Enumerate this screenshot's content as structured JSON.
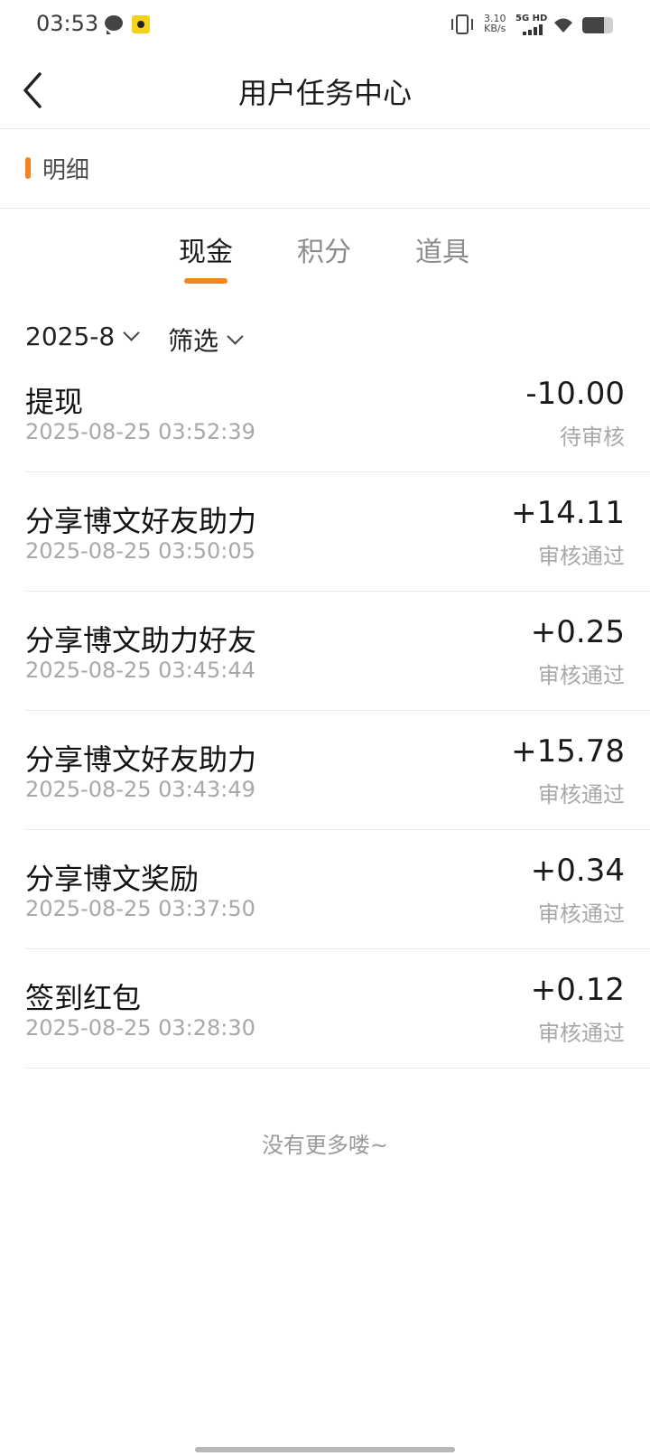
{
  "status_bar": {
    "time": "03:53",
    "speed_value": "3.10",
    "speed_unit": "KB/s",
    "network": "5G HD"
  },
  "header": {
    "title": "用户任务中心"
  },
  "section": {
    "title": "明细",
    "accent": "#f5831f"
  },
  "tabs": [
    {
      "label": "现金",
      "active": true
    },
    {
      "label": "积分",
      "active": false
    },
    {
      "label": "道具",
      "active": false
    }
  ],
  "filters": {
    "month": "2025-8",
    "filter_label": "筛选"
  },
  "records": [
    {
      "name": "提现",
      "time": "2025-08-25 03:52:39",
      "amount": "-10.00",
      "status": "待审核"
    },
    {
      "name": "分享博文好友助力",
      "time": "2025-08-25 03:50:05",
      "amount": "+14.11",
      "status": "审核通过"
    },
    {
      "name": "分享博文助力好友",
      "time": "2025-08-25 03:45:44",
      "amount": "+0.25",
      "status": "审核通过"
    },
    {
      "name": "分享博文好友助力",
      "time": "2025-08-25 03:43:49",
      "amount": "+15.78",
      "status": "审核通过"
    },
    {
      "name": "分享博文奖励",
      "time": "2025-08-25 03:37:50",
      "amount": "+0.34",
      "status": "审核通过"
    },
    {
      "name": "签到红包",
      "time": "2025-08-25 03:28:30",
      "amount": "+0.12",
      "status": "审核通过"
    }
  ],
  "footer_text": "没有更多喽~"
}
